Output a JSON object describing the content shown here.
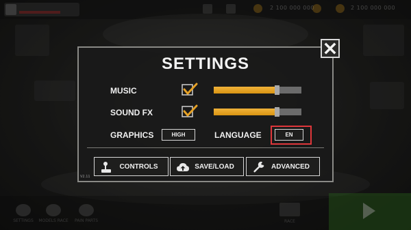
{
  "background": {
    "resources": [
      "2 100 000 000",
      "2 100 000 000"
    ],
    "bottom_menu": [
      "SETTINGS",
      "MODELS RACE",
      "PAIN PARTS"
    ],
    "race_label": "RACE"
  },
  "settings": {
    "title": "SETTINGS",
    "music": {
      "label": "MUSIC",
      "enabled": true,
      "volume_percent": 72
    },
    "sound_fx": {
      "label": "SOUND FX",
      "enabled": true,
      "volume_percent": 72
    },
    "graphics": {
      "label": "GRAPHICS",
      "value": "HIGH"
    },
    "language": {
      "label": "LANGUAGE",
      "value": "EN"
    },
    "buttons": {
      "controls": {
        "label": "CONTROLS",
        "icon": "joystick-icon"
      },
      "save_load": {
        "label": "SAVE/LOAD",
        "icon": "cloud-upload-icon"
      },
      "advanced": {
        "label": "ADVANCED",
        "icon": "wrench-icon"
      }
    },
    "version": "V2.11",
    "close_icon": "close-x-icon"
  },
  "colors": {
    "accent_orange": "#e5a126",
    "highlight_red": "#e0373b",
    "panel_border": "#8a8a86"
  }
}
